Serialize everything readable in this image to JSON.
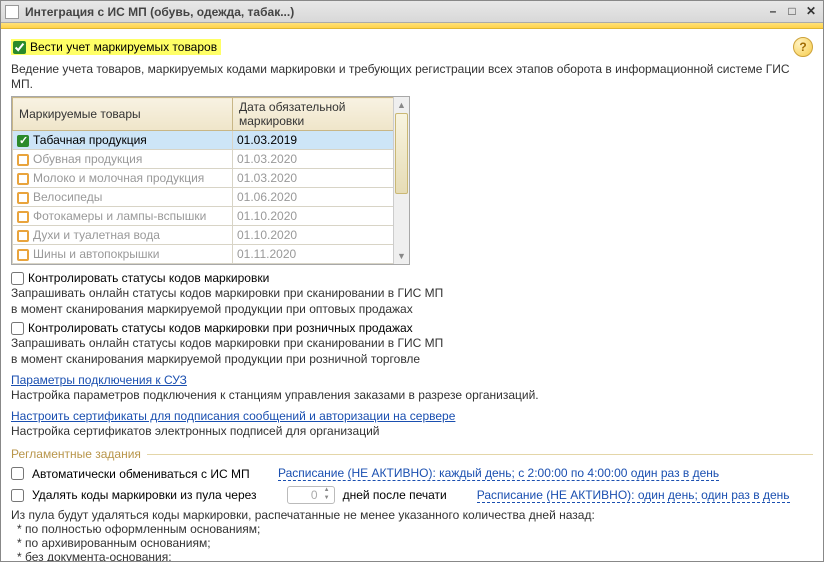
{
  "window": {
    "title": "Интеграция с ИС МП (обувь, одежда, табак...)"
  },
  "main_checkbox": {
    "label": "Вести учет маркируемых товаров",
    "checked": true
  },
  "description": "Ведение учета товаров, маркируемых кодами маркировки и требующих регистрации всех этапов оборота в информационной системе ГИС МП.",
  "table": {
    "col_product": "Маркируемые товары",
    "col_date": "Дата обязательной маркировки",
    "rows": [
      {
        "name": "Табачная продукция",
        "date": "01.03.2019",
        "checked": true,
        "selected": true
      },
      {
        "name": "Обувная продукция",
        "date": "01.03.2020",
        "checked": false,
        "selected": false
      },
      {
        "name": "Молоко и молочная продукция",
        "date": "01.03.2020",
        "checked": false,
        "selected": false
      },
      {
        "name": "Велосипеды",
        "date": "01.06.2020",
        "checked": false,
        "selected": false
      },
      {
        "name": "Фотокамеры и лампы-вспышки",
        "date": "01.10.2020",
        "checked": false,
        "selected": false
      },
      {
        "name": "Духи и туалетная вода",
        "date": "01.10.2020",
        "checked": false,
        "selected": false
      },
      {
        "name": "Шины и автопокрышки",
        "date": "01.11.2020",
        "checked": false,
        "selected": false
      }
    ]
  },
  "opts": {
    "control_label": "Контролировать статусы кодов маркировки",
    "control_sub1": "Запрашивать онлайн статусы кодов маркировки при сканировании в ГИС МП",
    "control_sub2": "в момент сканирования маркируемой продукции при оптовых продажах",
    "control_retail_label": "Контролировать статусы кодов маркировки при розничных продажах",
    "control_retail_sub1": "Запрашивать онлайн статусы кодов маркировки при сканировании в ГИС МП",
    "control_retail_sub2": "в момент сканирования маркируемой продукции при розничной торговле",
    "params_link": "Параметры подключения к СУЗ",
    "params_sub": "Настройка параметров подключения к станциям управления заказами в разрезе организаций.",
    "certs_link": "Настроить сертификаты для подписания сообщений и авторизации на сервере",
    "certs_sub": "Настройка сертификатов электронных подписей для организаций"
  },
  "section": {
    "title": "Регламентные задания"
  },
  "schedule": {
    "auto_label": "Автоматически обмениваться с ИС МП",
    "auto_link": "Расписание (НЕ АКТИВНО): каждый день; с 2:00:00 по 4:00:00 один раз в день",
    "delete_label": "Удалять коды маркировки из пула через",
    "delete_value": "0",
    "after_print": "дней после печати",
    "delete_link": "Расписание (НЕ АКТИВНО): один день; один раз в день"
  },
  "footnotes": {
    "line1": "Из пула будут удаляться коды маркировки, распечатанные не менее указанного количества дней назад:",
    "n1": "* по полностью оформленным основаниям;",
    "n2": "* по архивированным основаниям;",
    "n3": "* без документа-основания;"
  }
}
